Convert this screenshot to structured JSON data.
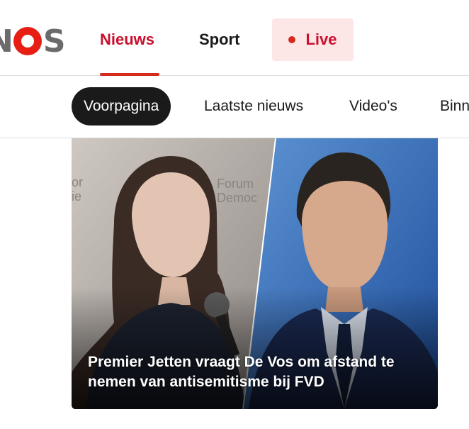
{
  "brand": {
    "logo": "NOS"
  },
  "nav": {
    "items": [
      {
        "label": "Nieuws",
        "active": true
      },
      {
        "label": "Sport",
        "active": false
      }
    ],
    "live_label": "Live"
  },
  "subnav": {
    "items": [
      {
        "label": "Voorpagina",
        "active": true
      },
      {
        "label": "Laatste nieuws",
        "active": false
      },
      {
        "label": "Video's",
        "active": false
      },
      {
        "label": "Binnenland",
        "active": false
      }
    ]
  },
  "hero": {
    "title": "Premier Jetten vraagt De Vos om afstand te nemen van antisemitisme bij FVD",
    "backdrop_text": "Forum voor Democratie"
  },
  "colors": {
    "accent": "#d52b1e",
    "accent_text": "#c8102e",
    "live_bg": "#fde6e6",
    "pill_active_bg": "#1a1a1a"
  }
}
